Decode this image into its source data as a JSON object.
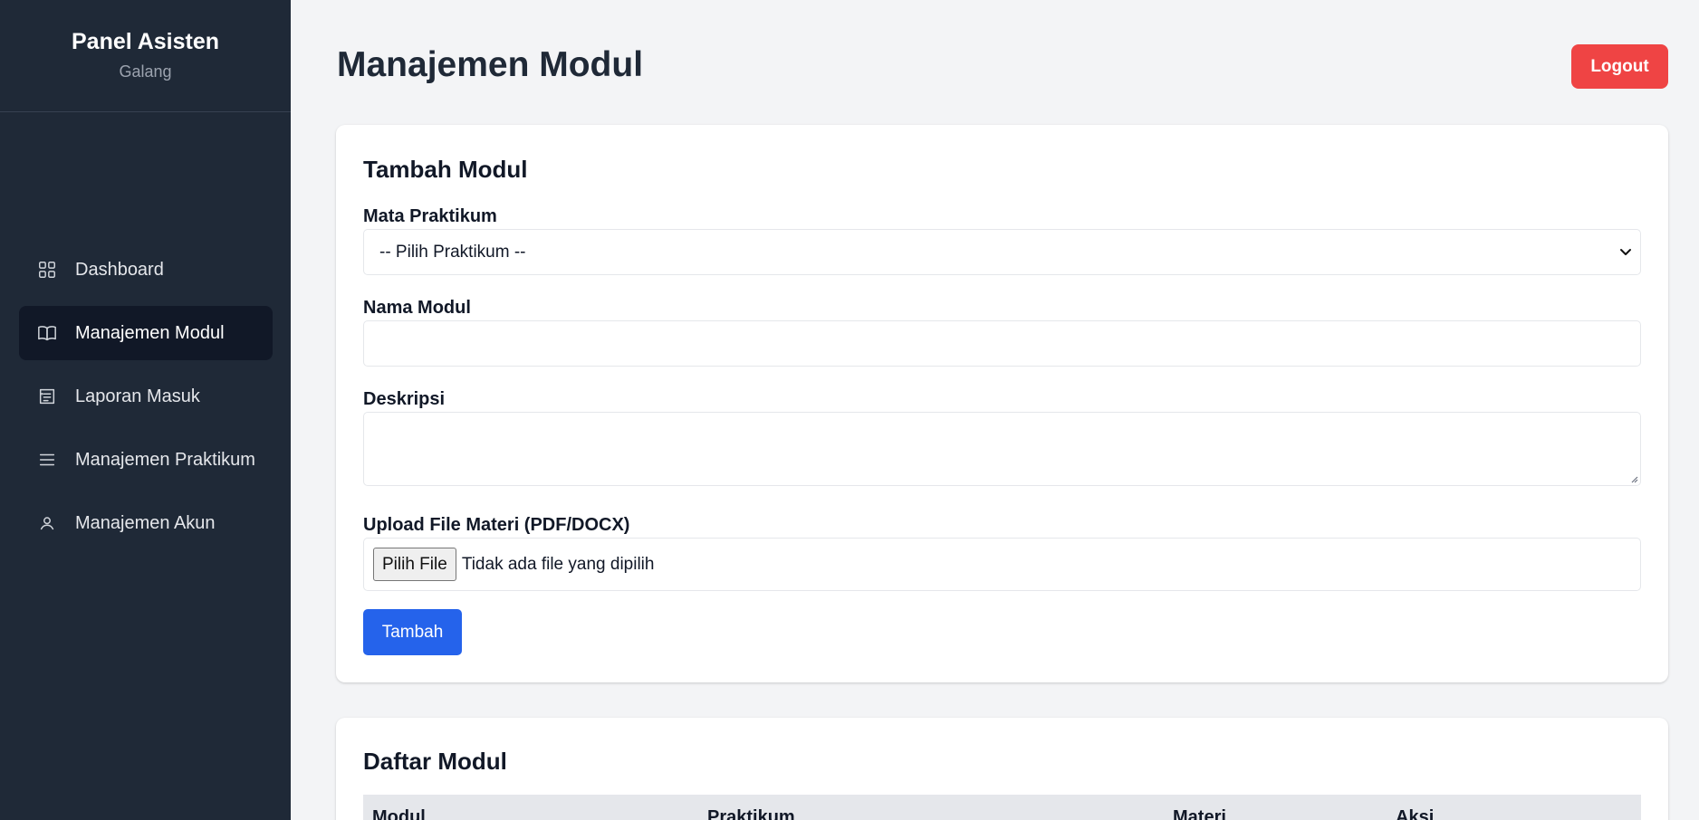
{
  "sidebar": {
    "title": "Panel Asisten",
    "user": "Galang",
    "items": [
      {
        "label": "Dashboard",
        "icon": "dashboard-grid-icon",
        "active": false
      },
      {
        "label": "Manajemen Modul",
        "icon": "book-open-icon",
        "active": true
      },
      {
        "label": "Laporan Masuk",
        "icon": "report-list-icon",
        "active": false
      },
      {
        "label": "Manajemen Praktikum",
        "icon": "menu-lines-icon",
        "active": false
      },
      {
        "label": "Manajemen Akun",
        "icon": "user-icon",
        "active": false
      }
    ]
  },
  "header": {
    "title": "Manajemen Modul",
    "logout_label": "Logout",
    "logout_color": "#ef4444"
  },
  "form": {
    "title": "Tambah Modul",
    "praktikum_label": "Mata Praktikum",
    "praktikum_selected": "-- Pilih Praktikum --",
    "nama_label": "Nama Modul",
    "nama_value": "",
    "deskripsi_label": "Deskripsi",
    "deskripsi_value": "",
    "file_label": "Upload File Materi (PDF/DOCX)",
    "file_button": "Pilih File",
    "file_status": "Tidak ada file yang dipilih",
    "submit_label": "Tambah",
    "submit_color": "#2563eb"
  },
  "list": {
    "title": "Daftar Modul",
    "columns": [
      "Modul",
      "Praktikum",
      "Materi",
      "Aksi"
    ]
  }
}
